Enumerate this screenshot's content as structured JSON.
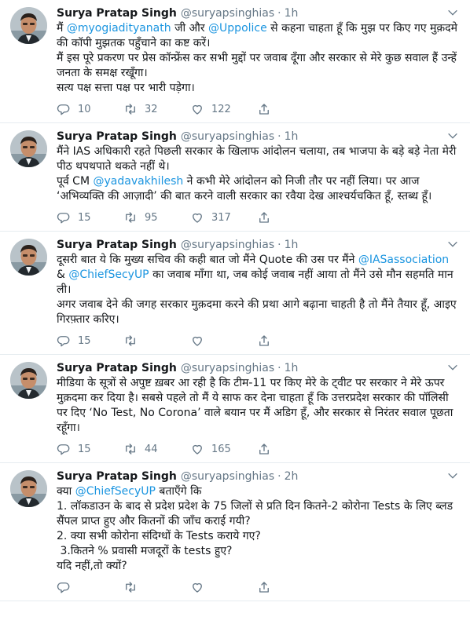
{
  "tweets": [
    {
      "name": "Surya Pratap Singh",
      "handle": "@suryapsinghias",
      "dot": "·",
      "time": "1h",
      "segments": [
        {
          "t": "मैं "
        },
        {
          "t": "@myogiadityanath",
          "m": true
        },
        {
          "t": " जी और "
        },
        {
          "t": "@Uppolice",
          "m": true
        },
        {
          "t": " से कहना चाहता हूँ कि मुझ पर किए गए मुक़दमे की कॉपी मुझतक पहुँचाने का कष्ट करें।\nमैं इस पूरे प्रकरण पर प्रेस कॉन्फ्रेंस कर सभी मुद्दों पर जवाब दूँगा और सरकार से मेरे कुछ सवाल हैं उन्हें जनता के समक्ष रखूँगा।\nसत्य पक्ष सत्ता पक्ष पर भारी पड़ेगा।"
        }
      ],
      "replies": "10",
      "retweets": "32",
      "likes": "122"
    },
    {
      "name": "Surya Pratap Singh",
      "handle": "@suryapsinghias",
      "dot": "·",
      "time": "1h",
      "segments": [
        {
          "t": "मैंने IAS अधिकारी रहते पिछली सरकार के खिलाफ आंदोलन चलाया, तब भाजपा के बड़े बड़े नेता मेरी पीठ थपथपाते थकते नहीं थे।\nपूर्व CM "
        },
        {
          "t": "@yadavakhilesh",
          "m": true
        },
        {
          "t": " ने कभी मेरे आंदोलन को निजी तौर पर नहीं लिया। पर आज ‘अभिव्यक्ति की आज़ादी’ की बात करने वाली सरकार का रवैया देख आश्चर्यचकित हूँ, स्तब्ध हूँ।"
        }
      ],
      "replies": "15",
      "retweets": "95",
      "likes": "317"
    },
    {
      "name": "Surya Pratap Singh",
      "handle": "@suryapsinghias",
      "dot": "·",
      "time": "1h",
      "segments": [
        {
          "t": "दूसरी बात ये कि मुख्य सचिव की कही बात जो मैंने Quote की उस पर मैंने "
        },
        {
          "t": "@IASassociation",
          "m": true
        },
        {
          "t": " & "
        },
        {
          "t": "@ChiefSecyUP",
          "m": true
        },
        {
          "t": " का जवाब माँगा था, जब कोई जवाब नहीं आया तो मैंने उसे मौन सहमति मान ली।\nअगर जवाब देने की जगह सरकार मुक़दमा करने की प्रथा आगे बढ़ाना चाहती है तो मैंने तैयार हूँ, आइए गिरफ़्तार करिए।"
        }
      ],
      "replies": "15",
      "retweets": "",
      "likes": ""
    },
    {
      "name": "Surya Pratap Singh",
      "handle": "@suryapsinghias",
      "dot": "·",
      "time": "1h",
      "segments": [
        {
          "t": "मीडिया के सूत्रों से अपुष्ट ख़बर आ रही है कि टीम-11 पर किए मेरे के ट्वीट पर सरकार ने मेरे ऊपर मुक़दमा कर दिया है। सबसे पहले तो मैं ये साफ कर देना चाहता हूँ कि उत्तरप्रदेश सरकार की पॉलिसी पर दिए ‘No Test, No Corona’ वाले बयान पर मैं अडिग हूँ, और सरकार से निरंतर सवाल पूछता रहूँगा।"
        }
      ],
      "replies": "15",
      "retweets": "44",
      "likes": "165"
    },
    {
      "name": "Surya Pratap Singh",
      "handle": "@suryapsinghias",
      "dot": "·",
      "time": "2h",
      "segments": [
        {
          "t": "क्या "
        },
        {
          "t": "@ChiefSecyUP",
          "m": true
        },
        {
          "t": " बताएँगे कि\n1. लॉकडाउन के बाद से प्रदेश प्रदेश के 75 जिलों से प्रति दिन कितने-2 कोरोना Tests के लिए ब्लड सैंपल प्राप्त हुए और कितनों की जाँच कराई गयी?\n2. क्या सभी कोरोना संदिग्धों के Tests कराये गए?\n 3.कितने % प्रवासी मजदूरों के tests हुए?\nयदि नहीं,तो क्यों?"
        }
      ],
      "replies": "",
      "retweets": "",
      "likes": ""
    }
  ]
}
